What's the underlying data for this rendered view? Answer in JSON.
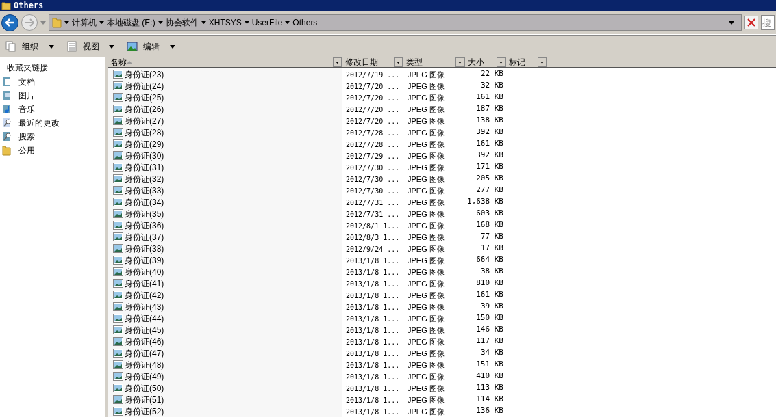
{
  "window": {
    "title": "Others"
  },
  "address_bar": {
    "breadcrumbs": [
      "计算机",
      "本地磁盘 (E:)",
      "协会软件",
      "XHTSYS",
      "UserFile",
      "Others"
    ]
  },
  "search": {
    "placeholder": "搜"
  },
  "toolbar": {
    "buttons": [
      {
        "label": "组织",
        "kind": "organize"
      },
      {
        "label": "视图",
        "kind": "views"
      },
      {
        "label": "编辑",
        "kind": "edit"
      }
    ]
  },
  "sidebar": {
    "title": "收藏夹链接",
    "items": [
      {
        "label": "文档",
        "kind": "documents"
      },
      {
        "label": "图片",
        "kind": "pictures"
      },
      {
        "label": "音乐",
        "kind": "music"
      },
      {
        "label": "最近的更改",
        "kind": "recent"
      },
      {
        "label": "搜索",
        "kind": "search"
      },
      {
        "label": "公用",
        "kind": "public"
      }
    ]
  },
  "table": {
    "columns": [
      {
        "label": "名称",
        "sorted": true
      },
      {
        "label": "修改日期",
        "sorted": false
      },
      {
        "label": "类型",
        "sorted": false
      },
      {
        "label": "大小",
        "sorted": false
      },
      {
        "label": "标记",
        "sorted": false
      }
    ],
    "rows": [
      {
        "name": "身份证(23)",
        "date": "2012/7/19 ...",
        "type": "JPEG 图像",
        "size": "22 KB"
      },
      {
        "name": "身份证(24)",
        "date": "2012/7/20 ...",
        "type": "JPEG 图像",
        "size": "32 KB"
      },
      {
        "name": "身份证(25)",
        "date": "2012/7/20 ...",
        "type": "JPEG 图像",
        "size": "161 KB"
      },
      {
        "name": "身份证(26)",
        "date": "2012/7/20 ...",
        "type": "JPEG 图像",
        "size": "187 KB"
      },
      {
        "name": "身份证(27)",
        "date": "2012/7/20 ...",
        "type": "JPEG 图像",
        "size": "138 KB"
      },
      {
        "name": "身份证(28)",
        "date": "2012/7/28 ...",
        "type": "JPEG 图像",
        "size": "392 KB"
      },
      {
        "name": "身份证(29)",
        "date": "2012/7/28 ...",
        "type": "JPEG 图像",
        "size": "161 KB"
      },
      {
        "name": "身份证(30)",
        "date": "2012/7/29 ...",
        "type": "JPEG 图像",
        "size": "392 KB"
      },
      {
        "name": "身份证(31)",
        "date": "2012/7/30 ...",
        "type": "JPEG 图像",
        "size": "171 KB"
      },
      {
        "name": "身份证(32)",
        "date": "2012/7/30 ...",
        "type": "JPEG 图像",
        "size": "205 KB"
      },
      {
        "name": "身份证(33)",
        "date": "2012/7/30 ...",
        "type": "JPEG 图像",
        "size": "277 KB"
      },
      {
        "name": "身份证(34)",
        "date": "2012/7/31 ...",
        "type": "JPEG 图像",
        "size": "1,638 KB"
      },
      {
        "name": "身份证(35)",
        "date": "2012/7/31 ...",
        "type": "JPEG 图像",
        "size": "603 KB"
      },
      {
        "name": "身份证(36)",
        "date": "2012/8/1 1...",
        "type": "JPEG 图像",
        "size": "168 KB"
      },
      {
        "name": "身份证(37)",
        "date": "2012/8/3 1...",
        "type": "JPEG 图像",
        "size": "77 KB"
      },
      {
        "name": "身份证(38)",
        "date": "2012/9/24 ...",
        "type": "JPEG 图像",
        "size": "17 KB"
      },
      {
        "name": "身份证(39)",
        "date": "2013/1/8 1...",
        "type": "JPEG 图像",
        "size": "664 KB"
      },
      {
        "name": "身份证(40)",
        "date": "2013/1/8 1...",
        "type": "JPEG 图像",
        "size": "38 KB"
      },
      {
        "name": "身份证(41)",
        "date": "2013/1/8 1...",
        "type": "JPEG 图像",
        "size": "810 KB"
      },
      {
        "name": "身份证(42)",
        "date": "2013/1/8 1...",
        "type": "JPEG 图像",
        "size": "161 KB"
      },
      {
        "name": "身份证(43)",
        "date": "2013/1/8 1...",
        "type": "JPEG 图像",
        "size": "39 KB"
      },
      {
        "name": "身份证(44)",
        "date": "2013/1/8 1...",
        "type": "JPEG 图像",
        "size": "150 KB"
      },
      {
        "name": "身份证(45)",
        "date": "2013/1/8 1...",
        "type": "JPEG 图像",
        "size": "146 KB"
      },
      {
        "name": "身份证(46)",
        "date": "2013/1/8 1...",
        "type": "JPEG 图像",
        "size": "117 KB"
      },
      {
        "name": "身份证(47)",
        "date": "2013/1/8 1...",
        "type": "JPEG 图像",
        "size": "34 KB"
      },
      {
        "name": "身份证(48)",
        "date": "2013/1/8 1...",
        "type": "JPEG 图像",
        "size": "151 KB"
      },
      {
        "name": "身份证(49)",
        "date": "2013/1/8 1...",
        "type": "JPEG 图像",
        "size": "410 KB"
      },
      {
        "name": "身份证(50)",
        "date": "2013/1/8 1...",
        "type": "JPEG 图像",
        "size": "113 KB"
      },
      {
        "name": "身份证(51)",
        "date": "2013/1/8 1...",
        "type": "JPEG 图像",
        "size": "114 KB"
      },
      {
        "name": "身份证(52)",
        "date": "2013/1/8 1...",
        "type": "JPEG 图像",
        "size": "136 KB"
      }
    ]
  }
}
